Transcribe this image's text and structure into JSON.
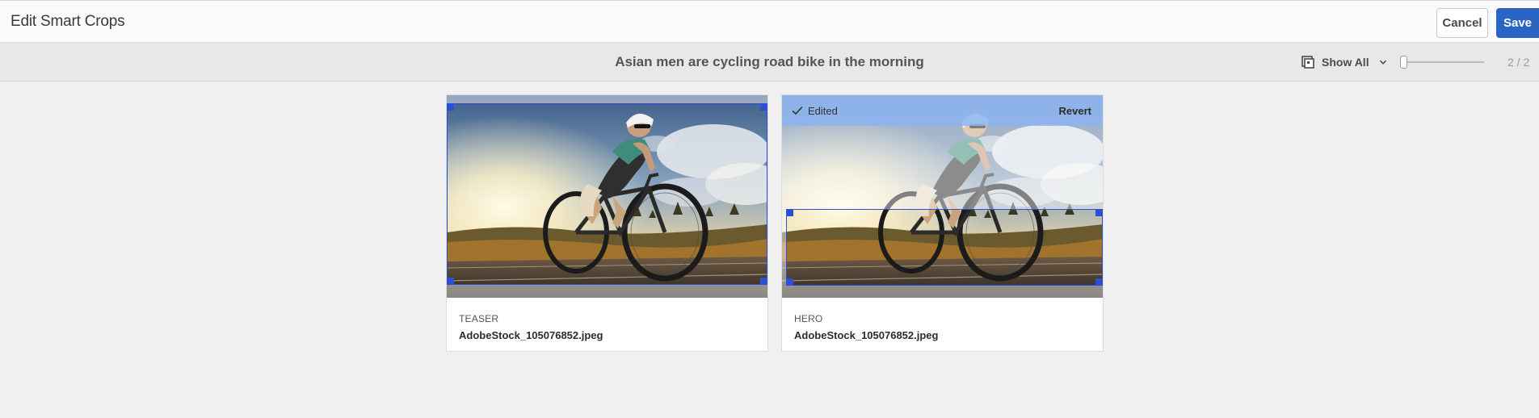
{
  "header": {
    "title": "Edit Smart Crops",
    "cancel_label": "Cancel",
    "save_label": "Save"
  },
  "toolbar": {
    "asset_title": "Asian men are cycling road bike in the morning",
    "show_all_label": "Show All",
    "pager": "2 / 2",
    "slider_value": 0
  },
  "cards": [
    {
      "label": "TEASER",
      "filename": "AdobeStock_105076852.jpeg"
    },
    {
      "label": "HERO",
      "filename": "AdobeStock_105076852.jpeg",
      "edited_label": "Edited",
      "revert_label": "Revert"
    }
  ],
  "colors": {
    "accent": "#2a64c5",
    "crop_border": "#2c4fd4",
    "edited_bar": "#8cb4f0"
  },
  "icons": {
    "show_all": "crop-grid-icon",
    "dropdown": "chevron-down-icon",
    "edited": "checkmark-icon"
  }
}
